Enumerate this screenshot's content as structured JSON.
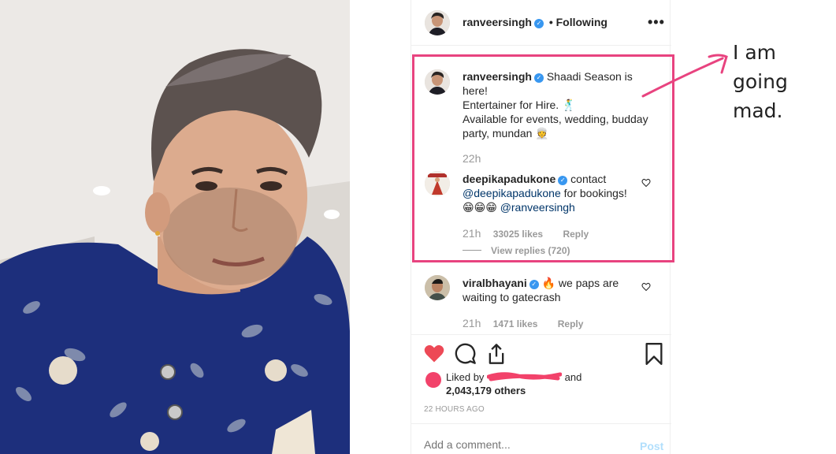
{
  "post": {
    "username": "ranveersingh",
    "follow_state": "Following",
    "more_label": "•••",
    "separator": "•"
  },
  "caption": {
    "username": "ranveersingh",
    "line1": "Shaadi Season is",
    "line2": "here!",
    "line3": "Entertainer for Hire.",
    "line4": "Available for events, wedding, budday",
    "line5": "party, mundan",
    "age": "22h"
  },
  "comments": [
    {
      "username": "deepikapadukone",
      "text1": "contact",
      "mention1": "@deepikapadukone",
      "text2": "for bookings!",
      "emoji": "😁😁😁",
      "mention2": "@ranveersingh",
      "age": "21h",
      "likes": "33025 likes",
      "reply": "Reply",
      "view_replies": "View replies (720)"
    },
    {
      "username": "viralbhayani",
      "emoji": "🔥",
      "text1": "we paps are",
      "text2": "waiting to gatecrash",
      "age": "21h",
      "likes": "1471 likes",
      "reply": "Reply"
    }
  ],
  "likes": {
    "prefix": "Liked by",
    "suffix": "and",
    "count": "2,043,179 others"
  },
  "timestamp": "22 HOURS AGO",
  "add_comment": {
    "placeholder": "Add a comment...",
    "post_label": "Post"
  },
  "annotation": {
    "line1": "I am",
    "line2": "going",
    "line3": "mad."
  },
  "colors": {
    "accent_blue": "#3897f0",
    "heart_red": "#ed4956",
    "highlight_pink": "#e8437f"
  },
  "icons": [
    "verified-badge-icon",
    "heart-icon",
    "comment-icon",
    "share-icon",
    "bookmark-icon",
    "more-icon"
  ]
}
